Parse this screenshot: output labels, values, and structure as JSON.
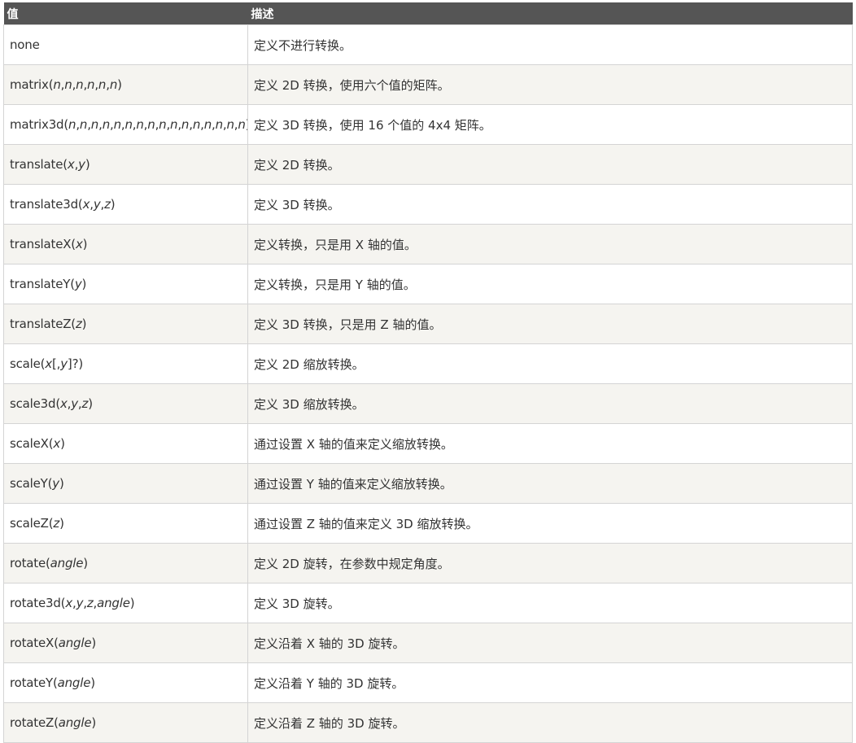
{
  "headers": [
    "值",
    "描述"
  ],
  "rows": [
    {
      "value": [
        {
          "t": "none"
        }
      ],
      "desc": "定义不进行转换。"
    },
    {
      "value": [
        {
          "t": "matrix("
        },
        {
          "t": "n",
          "i": true
        },
        {
          "t": ","
        },
        {
          "t": "n",
          "i": true
        },
        {
          "t": ","
        },
        {
          "t": "n",
          "i": true
        },
        {
          "t": ","
        },
        {
          "t": "n",
          "i": true
        },
        {
          "t": ","
        },
        {
          "t": "n",
          "i": true
        },
        {
          "t": ","
        },
        {
          "t": "n",
          "i": true
        },
        {
          "t": ")"
        }
      ],
      "desc": "定义 2D 转换，使用六个值的矩阵。"
    },
    {
      "value": [
        {
          "t": "matrix3d("
        },
        {
          "t": "n",
          "i": true
        },
        {
          "t": ","
        },
        {
          "t": "n",
          "i": true
        },
        {
          "t": ","
        },
        {
          "t": "n",
          "i": true
        },
        {
          "t": ","
        },
        {
          "t": "n",
          "i": true
        },
        {
          "t": ","
        },
        {
          "t": "n",
          "i": true
        },
        {
          "t": ","
        },
        {
          "t": "n",
          "i": true
        },
        {
          "t": ","
        },
        {
          "t": "n",
          "i": true
        },
        {
          "t": ","
        },
        {
          "t": "n",
          "i": true
        },
        {
          "t": ","
        },
        {
          "t": "n",
          "i": true
        },
        {
          "t": ","
        },
        {
          "t": "n",
          "i": true
        },
        {
          "t": ","
        },
        {
          "t": "n",
          "i": true
        },
        {
          "t": ","
        },
        {
          "t": "n",
          "i": true
        },
        {
          "t": ","
        },
        {
          "t": "n",
          "i": true
        },
        {
          "t": ","
        },
        {
          "t": "n",
          "i": true
        },
        {
          "t": ","
        },
        {
          "t": "n",
          "i": true
        },
        {
          "t": ","
        },
        {
          "t": "n",
          "i": true
        },
        {
          "t": ")"
        }
      ],
      "desc": "定义 3D 转换，使用 16 个值的 4x4 矩阵。"
    },
    {
      "value": [
        {
          "t": "translate("
        },
        {
          "t": "x",
          "i": true
        },
        {
          "t": ","
        },
        {
          "t": "y",
          "i": true
        },
        {
          "t": ")"
        }
      ],
      "desc": "定义 2D 转换。"
    },
    {
      "value": [
        {
          "t": "translate3d("
        },
        {
          "t": "x",
          "i": true
        },
        {
          "t": ","
        },
        {
          "t": "y",
          "i": true
        },
        {
          "t": ","
        },
        {
          "t": "z",
          "i": true
        },
        {
          "t": ")"
        }
      ],
      "desc": "定义 3D 转换。"
    },
    {
      "value": [
        {
          "t": "translateX("
        },
        {
          "t": "x",
          "i": true
        },
        {
          "t": ")"
        }
      ],
      "desc": "定义转换，只是用 X 轴的值。"
    },
    {
      "value": [
        {
          "t": "translateY("
        },
        {
          "t": "y",
          "i": true
        },
        {
          "t": ")"
        }
      ],
      "desc": "定义转换，只是用 Y 轴的值。"
    },
    {
      "value": [
        {
          "t": "translateZ("
        },
        {
          "t": "z",
          "i": true
        },
        {
          "t": ")"
        }
      ],
      "desc": "定义 3D 转换，只是用 Z 轴的值。"
    },
    {
      "value": [
        {
          "t": "scale("
        },
        {
          "t": "x",
          "i": true
        },
        {
          "t": "["
        },
        {
          "t": ","
        },
        {
          "t": "y",
          "i": true
        },
        {
          "t": "]?)"
        }
      ],
      "desc": "定义 2D 缩放转换。"
    },
    {
      "value": [
        {
          "t": "scale3d("
        },
        {
          "t": "x",
          "i": true
        },
        {
          "t": ","
        },
        {
          "t": "y",
          "i": true
        },
        {
          "t": ","
        },
        {
          "t": "z",
          "i": true
        },
        {
          "t": ")"
        }
      ],
      "desc": "定义 3D 缩放转换。"
    },
    {
      "value": [
        {
          "t": "scaleX("
        },
        {
          "t": "x",
          "i": true
        },
        {
          "t": ")"
        }
      ],
      "desc": "通过设置 X 轴的值来定义缩放转换。"
    },
    {
      "value": [
        {
          "t": "scaleY("
        },
        {
          "t": "y",
          "i": true
        },
        {
          "t": ")"
        }
      ],
      "desc": "通过设置 Y 轴的值来定义缩放转换。"
    },
    {
      "value": [
        {
          "t": "scaleZ("
        },
        {
          "t": "z",
          "i": true
        },
        {
          "t": ")"
        }
      ],
      "desc": "通过设置 Z 轴的值来定义 3D 缩放转换。"
    },
    {
      "value": [
        {
          "t": "rotate("
        },
        {
          "t": "angle",
          "i": true
        },
        {
          "t": ")"
        }
      ],
      "desc": "定义 2D 旋转，在参数中规定角度。"
    },
    {
      "value": [
        {
          "t": "rotate3d("
        },
        {
          "t": "x",
          "i": true
        },
        {
          "t": ","
        },
        {
          "t": "y",
          "i": true
        },
        {
          "t": ","
        },
        {
          "t": "z",
          "i": true
        },
        {
          "t": ","
        },
        {
          "t": "angle",
          "i": true
        },
        {
          "t": ")"
        }
      ],
      "desc": "定义 3D 旋转。"
    },
    {
      "value": [
        {
          "t": "rotateX("
        },
        {
          "t": "angle",
          "i": true
        },
        {
          "t": ")"
        }
      ],
      "desc": "定义沿着 X 轴的 3D 旋转。"
    },
    {
      "value": [
        {
          "t": "rotateY("
        },
        {
          "t": "angle",
          "i": true
        },
        {
          "t": ")"
        }
      ],
      "desc": "定义沿着 Y 轴的 3D 旋转。"
    },
    {
      "value": [
        {
          "t": "rotateZ("
        },
        {
          "t": "angle",
          "i": true
        },
        {
          "t": ")"
        }
      ],
      "desc": "定义沿着 Z 轴的 3D 旋转。"
    }
  ]
}
